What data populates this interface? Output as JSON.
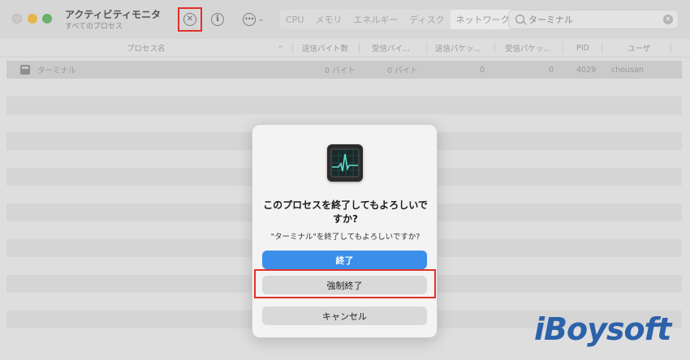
{
  "window": {
    "title": "アクティビティモニタ",
    "subtitle": "すべてのプロセス"
  },
  "toolbar": {
    "tabs": [
      "CPU",
      "メモリ",
      "エネルギー",
      "ディスク",
      "ネットワーク"
    ],
    "active_tab": "ネットワーク",
    "search_value": "ターミナル"
  },
  "table": {
    "columns": [
      "プロセス名",
      "送信バイト数",
      "受信バイ...",
      "送信パケッ...",
      "受信パケッ...",
      "PID",
      "ユーザ"
    ],
    "rows": [
      {
        "name": "ターミナル",
        "sent_bytes": "0 バイト",
        "recv_bytes": "0 バイト",
        "sent_packets": "0",
        "recv_packets": "0",
        "pid": "4029",
        "user": "chousan"
      }
    ]
  },
  "dialog": {
    "title": "このプロセスを終了してもよろしいですか?",
    "message": "\"ターミナル\"を終了してもよろしいですか?",
    "quit_label": "終了",
    "force_quit_label": "強制終了",
    "cancel_label": "キャンセル"
  },
  "watermark": "iBoysoft",
  "colors": {
    "highlight": "#e0302a",
    "primary_button": "#3b8eea",
    "watermark": "#2c62a9"
  },
  "icons": [
    "stop-process-icon",
    "info-icon",
    "more-actions-icon",
    "search-icon",
    "clear-search-icon",
    "terminal-app-icon",
    "activity-monitor-icon"
  ]
}
